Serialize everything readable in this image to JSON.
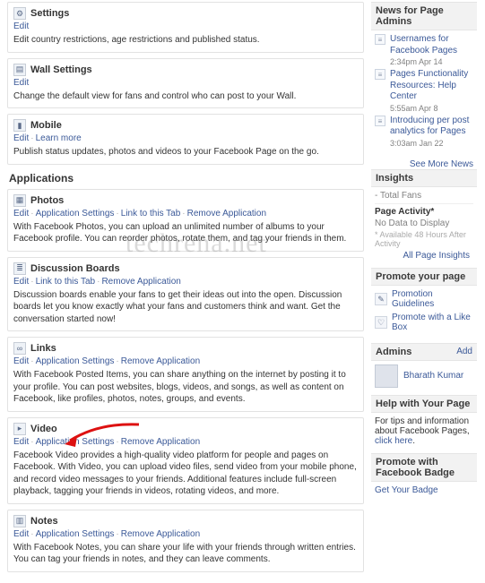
{
  "main": {
    "settings_boxes": [
      {
        "key": "settings",
        "icon": "gear-icon",
        "glyph": "⚙",
        "title": "Settings",
        "links": [
          {
            "label": "Edit",
            "key": "edit"
          }
        ],
        "desc": "Edit country restrictions, age restrictions and published status."
      },
      {
        "key": "wall-settings",
        "icon": "wall-icon",
        "glyph": "▤",
        "title": "Wall Settings",
        "links": [
          {
            "label": "Edit",
            "key": "edit"
          }
        ],
        "desc": "Change the default view for fans and control who can post to your Wall."
      },
      {
        "key": "mobile",
        "icon": "mobile-icon",
        "glyph": "▮",
        "title": "Mobile",
        "links": [
          {
            "label": "Edit",
            "key": "edit"
          },
          {
            "label": "Learn more",
            "key": "learn-more"
          }
        ],
        "desc": "Publish status updates, photos and videos to your Facebook Page on the go."
      }
    ],
    "apps_heading": "Applications",
    "app_boxes": [
      {
        "key": "photos",
        "icon": "photos-icon",
        "glyph": "▦",
        "title": "Photos",
        "links": [
          {
            "label": "Edit",
            "key": "edit"
          },
          {
            "label": "Application Settings",
            "key": "app-settings"
          },
          {
            "label": "Link to this Tab",
            "key": "link-tab"
          },
          {
            "label": "Remove Application",
            "key": "remove"
          }
        ],
        "desc": "With Facebook Photos, you can upload an unlimited number of albums to your Facebook profile. You can reorder photos, rotate them, and tag your friends in them."
      },
      {
        "key": "discussion-boards",
        "icon": "discussion-icon",
        "glyph": "≣",
        "title": "Discussion Boards",
        "links": [
          {
            "label": "Edit",
            "key": "edit"
          },
          {
            "label": "Link to this Tab",
            "key": "link-tab"
          },
          {
            "label": "Remove Application",
            "key": "remove"
          }
        ],
        "desc": "Discussion boards enable your fans to get their ideas out into the open. Discussion boards let you know exactly what your fans and customers think and want. Get the conversation started now!"
      },
      {
        "key": "links",
        "icon": "links-icon",
        "glyph": "∞",
        "title": "Links",
        "links": [
          {
            "label": "Edit",
            "key": "edit"
          },
          {
            "label": "Application Settings",
            "key": "app-settings"
          },
          {
            "label": "Remove Application",
            "key": "remove"
          }
        ],
        "desc": "With Facebook Posted Items, you can share anything on the internet by posting it to your profile. You can post websites, blogs, videos, and songs, as well as content on Facebook, like profiles, photos, notes, groups, and events."
      },
      {
        "key": "video",
        "icon": "video-icon",
        "glyph": "▸",
        "title": "Video",
        "links": [
          {
            "label": "Edit",
            "key": "edit"
          },
          {
            "label": "Application Settings",
            "key": "app-settings"
          },
          {
            "label": "Remove Application",
            "key": "remove"
          }
        ],
        "desc": "Facebook Video provides a high-quality video platform for people and pages on Facebook. With Video, you can upload video files, send video from your mobile phone, and record video messages to your friends. Additional features include full-screen playback, tagging your friends in videos, rotating videos, and more."
      },
      {
        "key": "notes",
        "icon": "notes-icon",
        "glyph": "▥",
        "title": "Notes",
        "links": [
          {
            "label": "Edit",
            "key": "edit"
          },
          {
            "label": "Application Settings",
            "key": "app-settings"
          },
          {
            "label": "Remove Application",
            "key": "remove"
          }
        ],
        "desc": "With Facebook Notes, you can share your life with your friends through written entries. You can tag your friends in notes, and they can leave comments."
      }
    ]
  },
  "side": {
    "news_heading": "News for Page Admins",
    "news": [
      {
        "title": "Usernames for Facebook Pages",
        "time": "2:34pm Apr 14"
      },
      {
        "title": "Pages Functionality Resources: Help Center",
        "time": "5:55am Apr 8"
      },
      {
        "title": "Introducing per post analytics for Pages",
        "time": "3:03am Jan 22"
      }
    ],
    "see_more_news": "See More News",
    "insights_heading": "Insights",
    "insights": {
      "total_fans_label": "Total Fans",
      "total_fans_value": "-",
      "activity_heading": "Page Activity*",
      "no_data": "No Data to Display",
      "footnote": "* Available 48 Hours After Activity",
      "all_link": "All Page Insights"
    },
    "promote_heading": "Promote your page",
    "promote": [
      {
        "label": "Promotion Guidelines",
        "key": "promo-guidelines",
        "glyph": "✎"
      },
      {
        "label": "Promote with a Like Box",
        "key": "promo-likebox",
        "glyph": "♡"
      }
    ],
    "admins_heading": "Admins",
    "admins_add": "Add",
    "admin_name": "Bharath Kumar",
    "help_heading": "Help with Your Page",
    "help_prefix": "For tips and information about Facebook Pages, ",
    "help_link": "click here",
    "help_suffix": ".",
    "badge_heading": "Promote with Facebook Badge",
    "badge_link": "Get Your Badge"
  },
  "watermark": "techrena.net"
}
